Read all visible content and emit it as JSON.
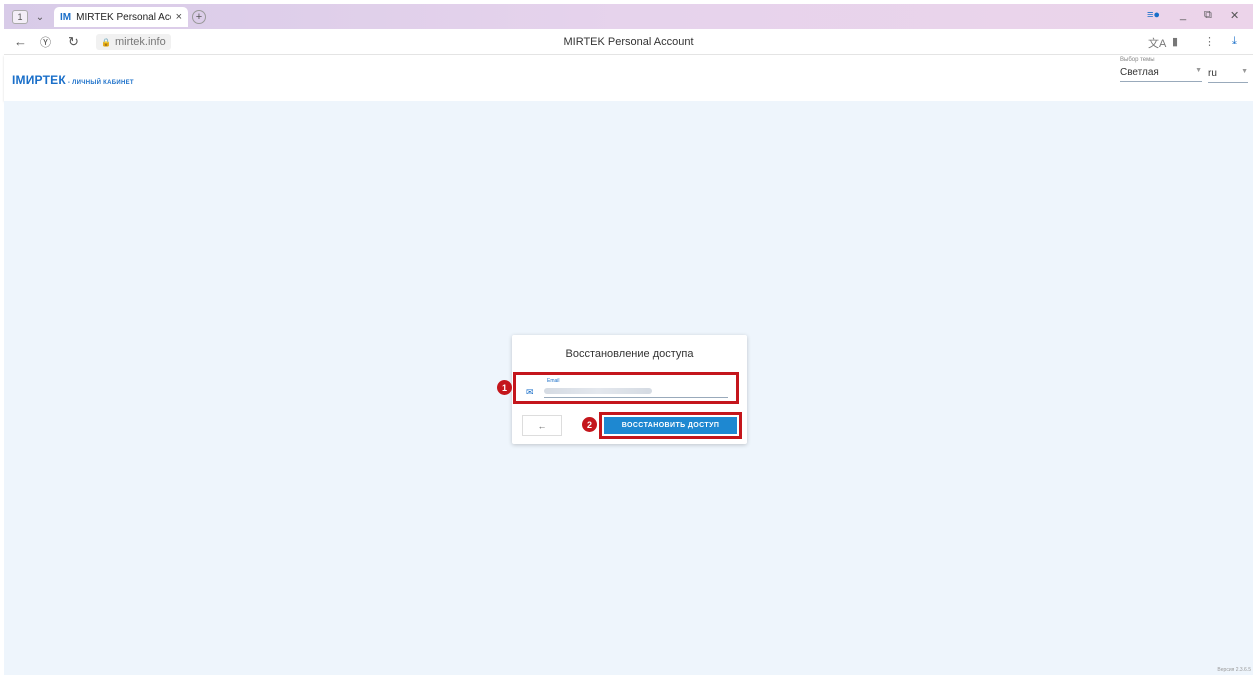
{
  "browser": {
    "tab_count": "1",
    "tab_title": "MIRTEK Personal Accou",
    "tab_favicon": "IM",
    "address": "mirtek.info",
    "page_title": "MIRTEK Personal Account"
  },
  "app": {
    "logo_brand": "IMИРТЕК",
    "logo_sub": "- ЛИЧНЫЙ КАБИНЕТ",
    "theme_label": "Выбор темы",
    "theme_value": "Светлая",
    "lang_value": "ru",
    "version": "Версия 2.3.6.5"
  },
  "recovery": {
    "title": "Восстановление доступа",
    "email_label": "Email",
    "back_icon": "←",
    "submit_label": "ВОССТАНОВИТЬ ДОСТУП"
  },
  "annotations": {
    "marker_1": "1",
    "marker_2": "2",
    "highlight_color": "#c4161c"
  },
  "colors": {
    "accent": "#1e88d1",
    "brand": "#1a6fc9",
    "background": "#eef5fc"
  }
}
